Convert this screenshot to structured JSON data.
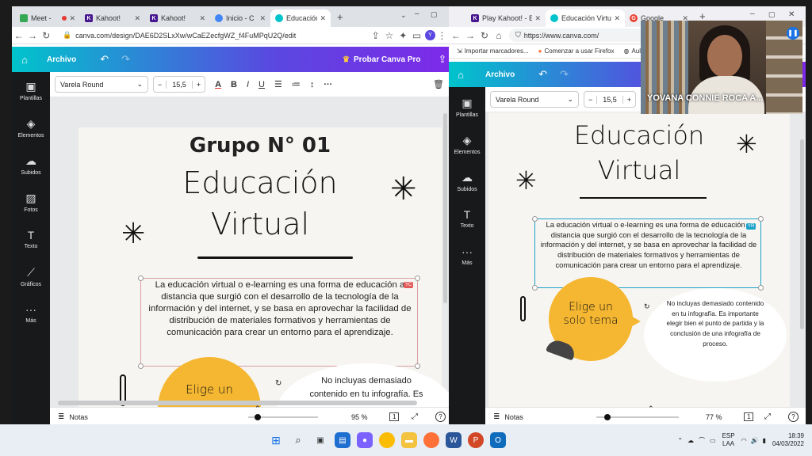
{
  "left": {
    "tabs": [
      {
        "label": "Meet - ",
        "icon": "meet-icon",
        "color": "#34a853"
      },
      {
        "label": "Kahoot!",
        "icon": "kahoot-icon",
        "color": "#46178f"
      },
      {
        "label": "Kahoot!",
        "icon": "kahoot-icon",
        "color": "#46178f"
      },
      {
        "label": "Inicio - C",
        "icon": "chrome-icon",
        "color": "#4285f4"
      },
      {
        "label": "Educación",
        "icon": "canva-icon",
        "color": "#00c4cc"
      }
    ],
    "url": "canva.com/design/DAE6D2SLxXw/wCaEZecfgWZ_f4FuMPqU2Q/edit",
    "profile": "Y",
    "archivo": "Archivo",
    "pro": "Probar Canva Pro",
    "sidebar": [
      "Plantillas",
      "Elementos",
      "Subidos",
      "Fotos",
      "Texto",
      "Gráficos",
      "Más"
    ],
    "font": "Varela Round",
    "size": "15,5",
    "group": "Grupo N° 01",
    "title1": "Educación",
    "title2": "Virtual",
    "body": "La educación virtual o e-learning es una forma de educación a distancia que surgió con el desarrollo de la tecnología de la información y del internet, y se basa en aprovechar la facilidad de distribución de materiales formativos y herramientas de comunicación para crear un entorno para el aprendizaje.",
    "badge": "YC",
    "circle": "Elige un",
    "bubble": "No incluyas demasiado contenido en tu infografía. Es",
    "notes": "Notas",
    "zoom": "95 %",
    "page": "1"
  },
  "right": {
    "tabs": [
      {
        "label": "Play Kahoot! - E",
        "icon": "kahoot-icon",
        "color": "#46178f"
      },
      {
        "label": "Educación Virtu",
        "icon": "canva-icon",
        "color": "#00c4cc"
      },
      {
        "label": "Google",
        "icon": "google-icon",
        "color": "#ea4335"
      }
    ],
    "url": "https://www.canva.com/",
    "bookmarks": [
      "Importar marcadores...",
      "Comenzar a usar Firefox",
      "Aula"
    ],
    "archivo": "Archivo",
    "sidebar": [
      "Plantillas",
      "Elementos",
      "Subidos",
      "Texto",
      "Más"
    ],
    "font": "Varela Round",
    "size": "15,5",
    "title1": "Educación",
    "title2": "Virtual",
    "body": "La educación virtual o e-learning es una forma de educación a distancia que surgió con el desarrollo de la tecnología de la información y del internet, y se basa en aprovechar la facilidad de distribución de materiales formativos y herramientas de comunicación para crear un entorno para el aprendizaje.",
    "badge": "YR",
    "circle": "Elige un solo tema",
    "bubble": "No incluyas demasiado contenido en tu infografía. Es importante elegir bien el punto de partida y la conclusión de una infografía de proceso.",
    "notes": "Notas",
    "zoom": "77 %",
    "page": "1"
  },
  "video": {
    "name": "YOVANA CONNIE ROCA A..."
  },
  "taskbar": {
    "lang1": "ESP",
    "lang2": "LAA",
    "time": "18:39",
    "date": "04/03/2022"
  }
}
